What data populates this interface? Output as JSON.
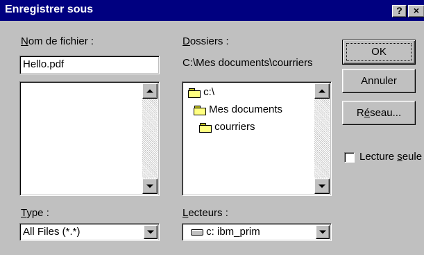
{
  "window": {
    "title": "Enregistrer sous",
    "help_button": "?",
    "close_button": "×"
  },
  "filename": {
    "label_accel": "N",
    "label_rest": "om de fichier :",
    "value": "Hello.pdf"
  },
  "file_list": {
    "items": []
  },
  "folders": {
    "label_accel": "D",
    "label_rest": "ossiers :",
    "current_path": "C:\\Mes documents\\courriers",
    "tree": [
      {
        "label": "c:\\",
        "icon": "open-folder-icon"
      },
      {
        "label": "Mes documents",
        "icon": "open-folder-icon"
      },
      {
        "label": "courriers",
        "icon": "open-folder-icon"
      }
    ]
  },
  "type": {
    "label_accel": "T",
    "label_rest": "ype :",
    "selected": "All Files (*.*)"
  },
  "drives": {
    "label_accel": "L",
    "label_rest": "ecteurs :",
    "selected": "c: ibm_prim",
    "icon": "hard-drive-icon"
  },
  "buttons": {
    "ok": "OK",
    "cancel": "Annuler",
    "network_pre": "R",
    "network_accel": "é",
    "network_post": "seau..."
  },
  "read_only": {
    "label_pre": "Lecture ",
    "label_accel": "s",
    "label_post": "eule",
    "checked": false
  },
  "colors": {
    "titlebar": "#000080",
    "dialog_face": "#c0c0c0"
  }
}
